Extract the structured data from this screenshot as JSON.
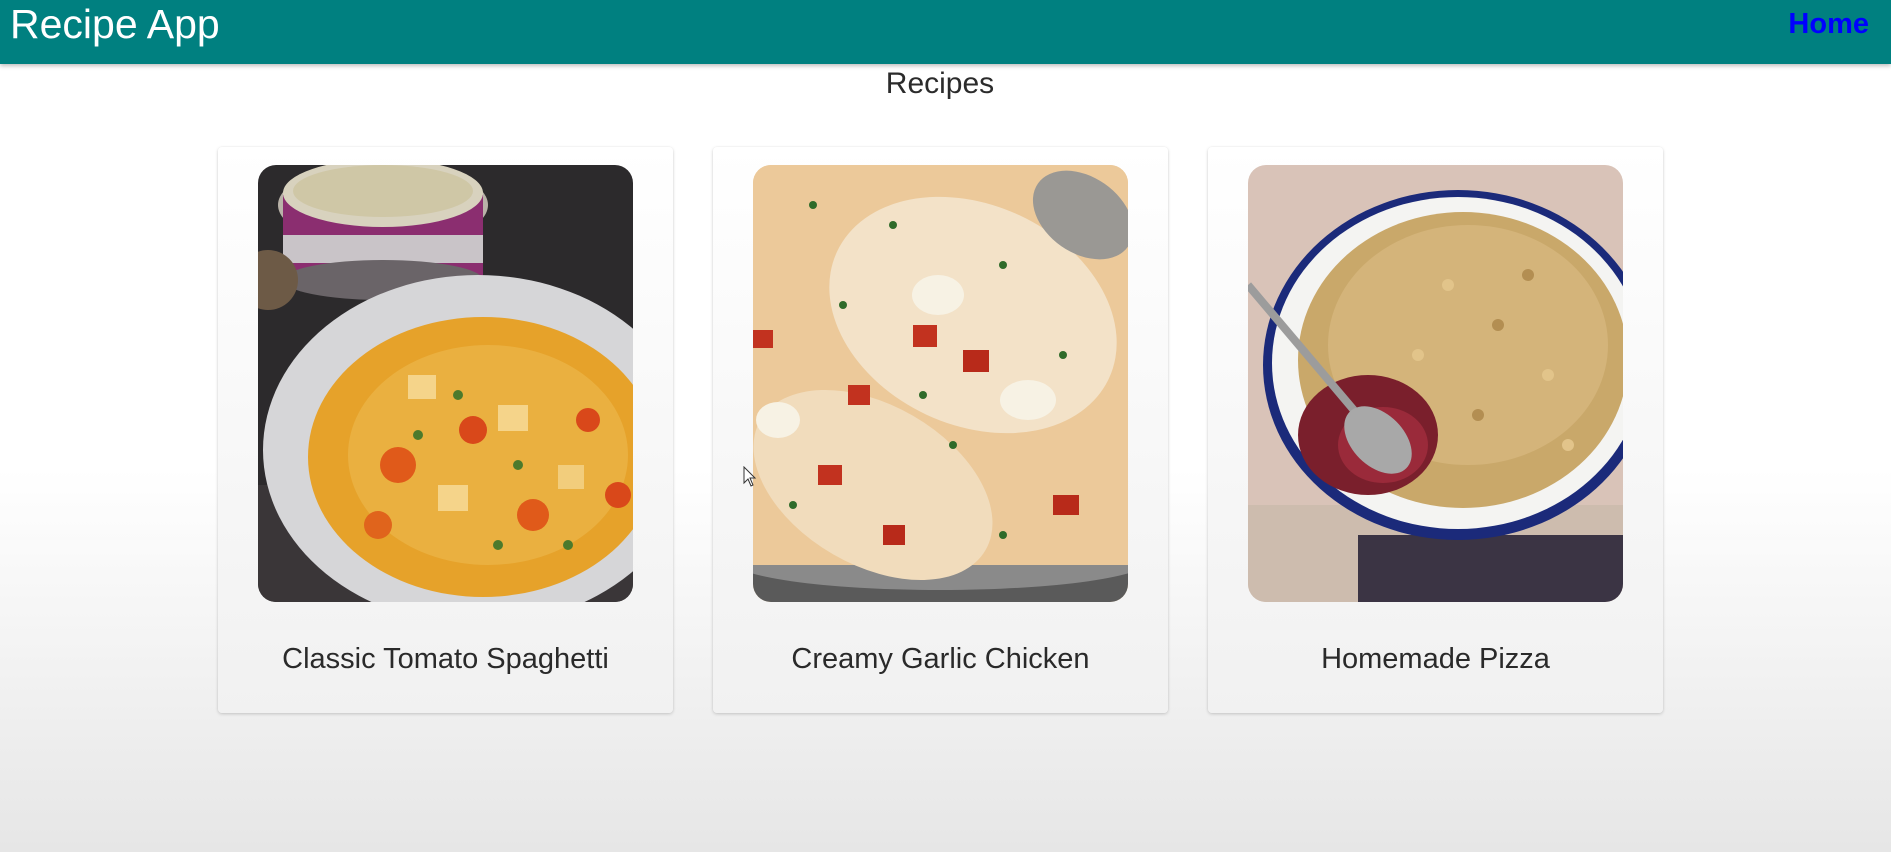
{
  "header": {
    "app_title": "Recipe App",
    "home_label": "Home",
    "background_color": "#008080",
    "link_color": "#0000ff"
  },
  "main": {
    "heading": "Recipes",
    "recipes": [
      {
        "title": "Classic Tomato Spaghetti",
        "image": "vegetable-curry-bowl-photo"
      },
      {
        "title": "Creamy Garlic Chicken",
        "image": "creamy-garlic-chicken-pan-photo"
      },
      {
        "title": "Homemade Pizza",
        "image": "crumble-dish-with-spoon-photo"
      }
    ]
  }
}
